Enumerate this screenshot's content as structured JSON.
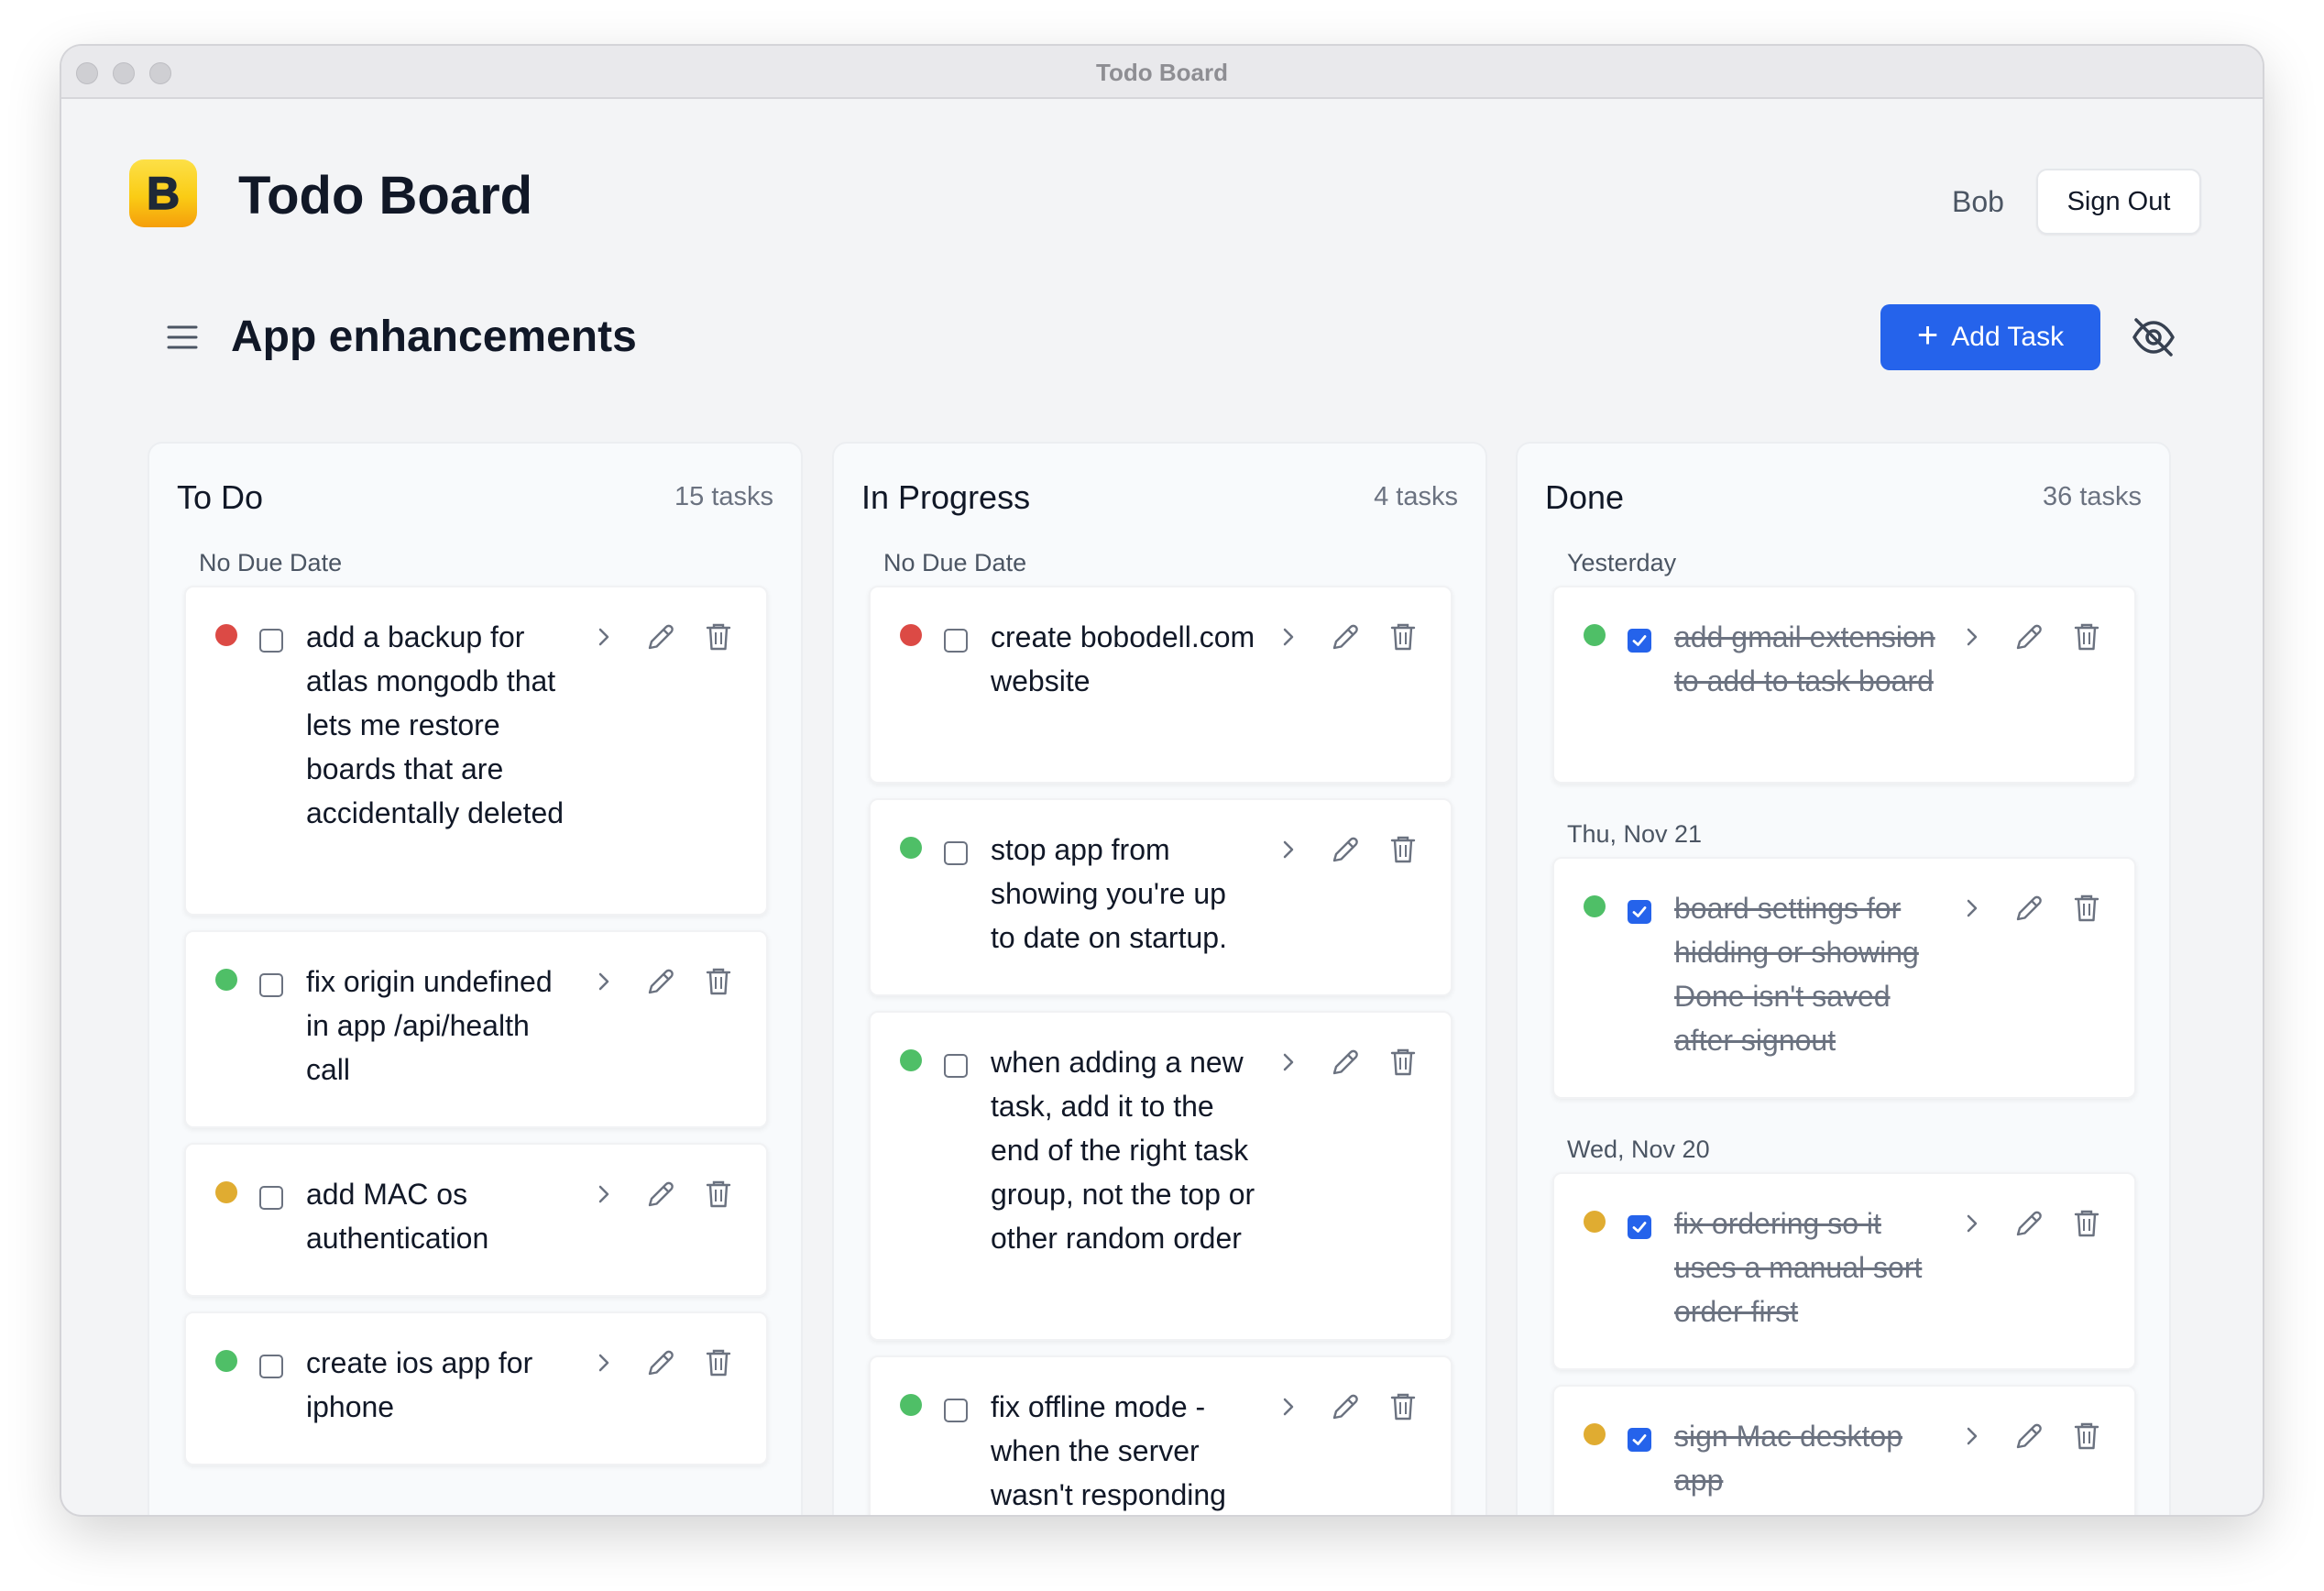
{
  "window": {
    "title": "Todo Board"
  },
  "header": {
    "app_title": "Todo Board",
    "user": "Bob",
    "sign_out": "Sign Out",
    "logo_letter": "B"
  },
  "toolbar": {
    "board_title": "App enhancements",
    "add_task": "Add Task",
    "add_icon": "+"
  },
  "colors": {
    "accent": "#2563eb",
    "priority_high": "#dc4a45",
    "priority_low": "#4fbf67",
    "priority_medium": "#e0ac31"
  },
  "columns": [
    {
      "title": "To Do",
      "count": "15 tasks",
      "groups": [
        {
          "label": "No Due Date",
          "cards": [
            {
              "priority": "red",
              "checked": false,
              "text": "add a backup for atlas mongodb that lets me restore boards that are accidentally deleted"
            },
            {
              "priority": "green",
              "checked": false,
              "text": "fix origin undefined in app /api/health call"
            },
            {
              "priority": "yellow",
              "checked": false,
              "text": "add MAC os authentication"
            },
            {
              "priority": "green",
              "checked": false,
              "text": "create ios app for iphone"
            }
          ]
        }
      ]
    },
    {
      "title": "In Progress",
      "count": "4 tasks",
      "groups": [
        {
          "label": "No Due Date",
          "cards": [
            {
              "priority": "red",
              "checked": false,
              "text": "create bobodell.com website"
            },
            {
              "priority": "green",
              "checked": false,
              "text": "stop app from showing you're up to date on startup."
            },
            {
              "priority": "green",
              "checked": false,
              "text": "when adding a new task, add it to the end of the right task group, not the top or other random order"
            },
            {
              "priority": "green",
              "checked": false,
              "text": "fix offline mode - when the server wasn't responding"
            }
          ]
        }
      ]
    },
    {
      "title": "Done",
      "count": "36 tasks",
      "groups": [
        {
          "label": "Yesterday",
          "cards": [
            {
              "priority": "green",
              "checked": true,
              "text": "add gmail extension to add to task board"
            }
          ]
        },
        {
          "label": "Thu, Nov 21",
          "cards": [
            {
              "priority": "green",
              "checked": true,
              "text": "board settings for hidding or showing Done isn't saved after signout"
            }
          ]
        },
        {
          "label": "Wed, Nov 20",
          "cards": [
            {
              "priority": "yellow",
              "checked": true,
              "text": "fix ordering so it uses a manual sort order first"
            },
            {
              "priority": "yellow",
              "checked": true,
              "text": "sign Mac desktop app"
            }
          ]
        }
      ]
    }
  ]
}
